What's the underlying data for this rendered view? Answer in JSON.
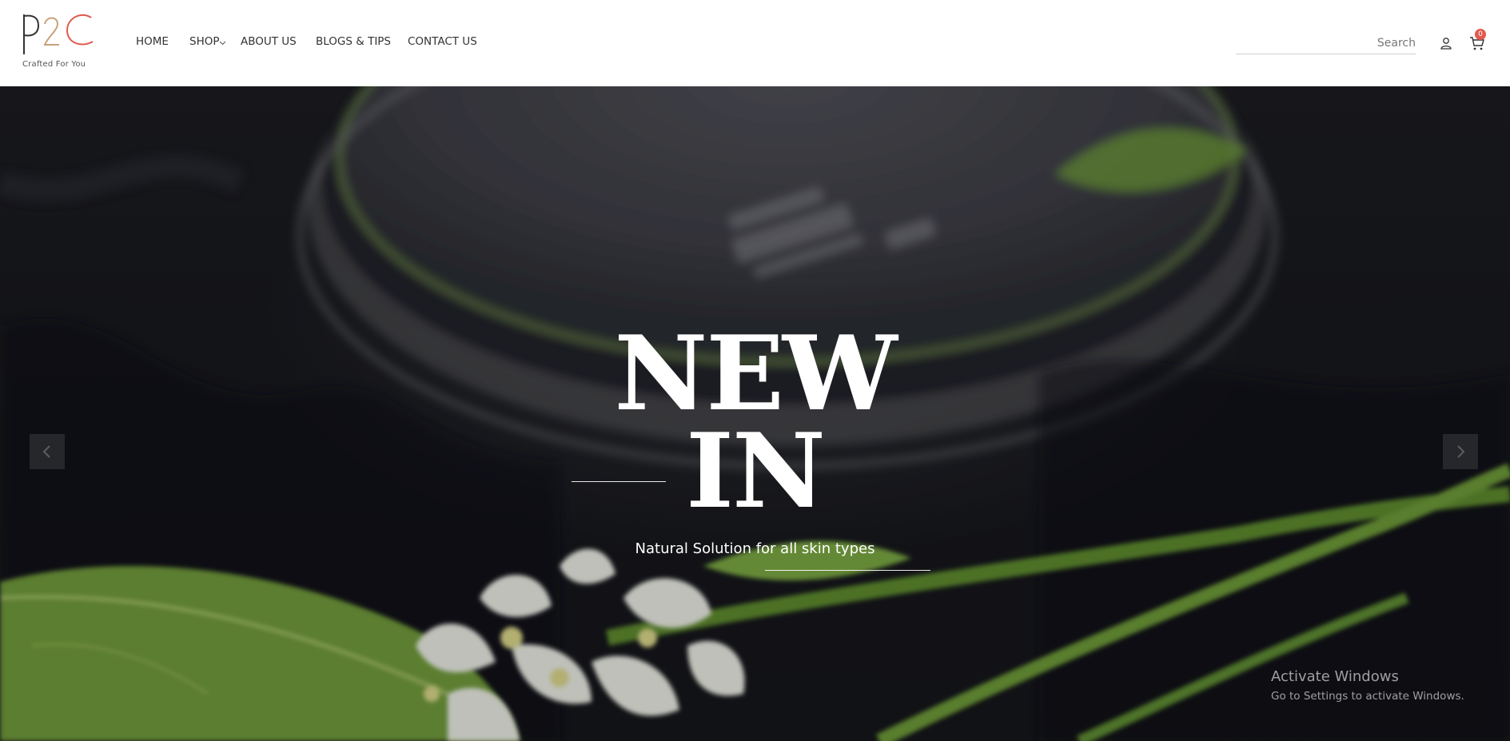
{
  "brand": {
    "logo_text": "P2C",
    "tagline": "Crafted For You"
  },
  "nav": {
    "items": [
      {
        "label": "HOME"
      },
      {
        "label": "SHOP"
      },
      {
        "label": "ABOUT US"
      },
      {
        "label": "BLOGS & TIPS"
      },
      {
        "label": "CONTACT US"
      }
    ]
  },
  "search": {
    "placeholder": "Search",
    "value": ""
  },
  "cart": {
    "count": "0"
  },
  "hero": {
    "line1": "NEW",
    "line2": "IN",
    "subtitle": "Natural Solution for all skin types"
  },
  "watermark": {
    "title": "Activate Windows",
    "subtitle": "Go to Settings to activate Windows."
  },
  "colors": {
    "accent_red": "#e05a4e",
    "logo_tan": "#c9a27a",
    "hero_bg": "#1b1c21",
    "leaf_green": "#6f9a3a"
  },
  "icons": [
    "chevron-down-icon",
    "user-icon",
    "cart-icon",
    "chevron-left-icon",
    "chevron-right-icon"
  ]
}
